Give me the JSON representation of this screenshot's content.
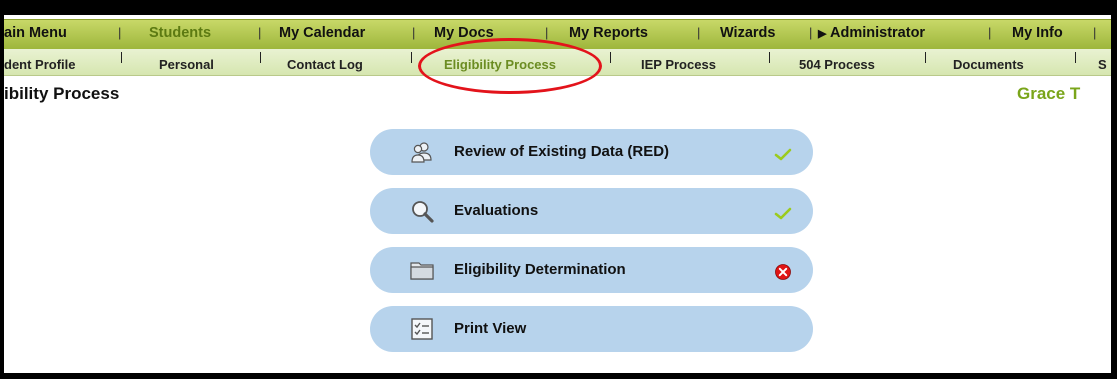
{
  "top_nav": {
    "items": [
      "ain Menu",
      "Students",
      "My Calendar",
      "My Docs",
      "My Reports",
      "Wizards",
      "Administrator",
      "My Info"
    ],
    "selected": "Students",
    "separator": "|",
    "admin_arrow": "▶"
  },
  "sub_nav": {
    "items": [
      "dent Profile",
      "Personal",
      "Contact Log",
      "Eligibility Process",
      "IEP Process",
      "504 Process",
      "Documents",
      "S"
    ],
    "selected": "Eligibility Process"
  },
  "page": {
    "title": "ibility Process",
    "student_name": "Grace T"
  },
  "steps": [
    {
      "label": "Review of Existing Data (RED)",
      "icon": "people-icon",
      "status": "complete"
    },
    {
      "label": "Evaluations",
      "icon": "magnifier-icon",
      "status": "complete"
    },
    {
      "label": "Eligibility Determination",
      "icon": "folder-icon",
      "status": "incomplete"
    },
    {
      "label": "Print View",
      "icon": "checklist-icon",
      "status": ""
    }
  ],
  "colors": {
    "top_nav": "#b2c84f",
    "sub_nav": "#e0ecc0",
    "step_pill": "#b7d3ec",
    "student_name": "#7aa51a",
    "check": "#9bcb1e",
    "error": "#e01515",
    "highlight": "#e3131b"
  }
}
